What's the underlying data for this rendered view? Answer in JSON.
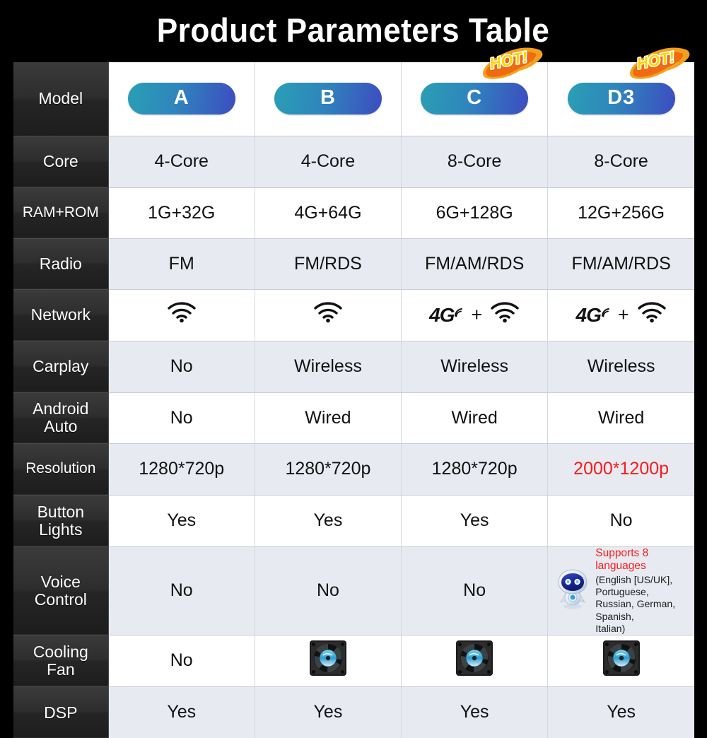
{
  "title": "Product Parameters Table",
  "colors": {
    "background": "#000000",
    "title_text": "#ffffff",
    "badge_gradient_start": "#2a9fb4",
    "badge_gradient_end": "#3d4cc0",
    "label_column_bg": "#2d2d2d",
    "row_band_a": "#e7ebf1",
    "row_band_b": "#ffffff",
    "highlight_red": "#fb1b1b",
    "hot_flame": "#f26a11",
    "hot_text": "#ffd400"
  },
  "table": {
    "row_header_label": "Model",
    "columns": [
      {
        "model": "A",
        "hot": false
      },
      {
        "model": "B",
        "hot": false
      },
      {
        "model": "C",
        "hot": true
      },
      {
        "model": "D3",
        "hot": true
      }
    ],
    "hot_badge_label": "HOT!",
    "rows": [
      {
        "label": "Core",
        "label_lines": [
          "Core"
        ],
        "values": [
          "4-Core",
          "4-Core",
          "8-Core",
          "8-Core"
        ]
      },
      {
        "label": "RAM+ROM",
        "label_lines": [
          "RAM+ROM"
        ],
        "values": [
          "1G+32G",
          "4G+64G",
          "6G+128G",
          "12G+256G"
        ]
      },
      {
        "label": "Radio",
        "label_lines": [
          "Radio"
        ],
        "values": [
          "FM",
          "FM/RDS",
          "FM/AM/RDS",
          "FM/AM/RDS"
        ]
      },
      {
        "label": "Network",
        "label_lines": [
          "Network"
        ],
        "values": [
          "wifi",
          "wifi",
          "4g-plus-wifi",
          "4g-plus-wifi"
        ]
      },
      {
        "label": "Carplay",
        "label_lines": [
          "Carplay"
        ],
        "values": [
          "No",
          "Wireless",
          "Wireless",
          "Wireless"
        ]
      },
      {
        "label": "Android Auto",
        "label_lines": [
          "Android",
          "Auto"
        ],
        "values": [
          "No",
          "Wired",
          "Wired",
          "Wired"
        ]
      },
      {
        "label": "Resolution",
        "label_lines": [
          "Resolution"
        ],
        "values": [
          "1280*720p",
          "1280*720p",
          "1280*720p",
          "2000*1200p"
        ]
      },
      {
        "label": "Button Lights",
        "label_lines": [
          "Button",
          "Lights"
        ],
        "values": [
          "Yes",
          "Yes",
          "Yes",
          "No"
        ]
      },
      {
        "label": "Voice Control",
        "label_lines": [
          "Voice",
          "Control"
        ],
        "values": [
          "No",
          "No",
          "No",
          "languages-cell"
        ]
      },
      {
        "label": "Cooling Fan",
        "label_lines": [
          "Cooling",
          "Fan"
        ],
        "values": [
          "No",
          "fan-icon",
          "fan-icon",
          "fan-icon"
        ]
      },
      {
        "label": "DSP",
        "label_lines": [
          "DSP"
        ],
        "values": [
          "Yes",
          "Yes",
          "Yes",
          "Yes"
        ]
      }
    ]
  },
  "languages_cell": {
    "headline": "Supports 8 languages",
    "detail": "(English [US/UK], Portuguese, Russian, German, Spanish, Italian)",
    "detail_lines": [
      "(English [US/UK], Portuguese,",
      "Russian, German, Spanish,",
      "Italian)"
    ],
    "icon": "robot-icon"
  },
  "icons": {
    "wifi": "wifi-icon",
    "four_g": "4g-icon",
    "plus": "+",
    "fan": "cooling-fan-icon",
    "robot": "robot-icon",
    "hot": "hot-flame-icon"
  }
}
